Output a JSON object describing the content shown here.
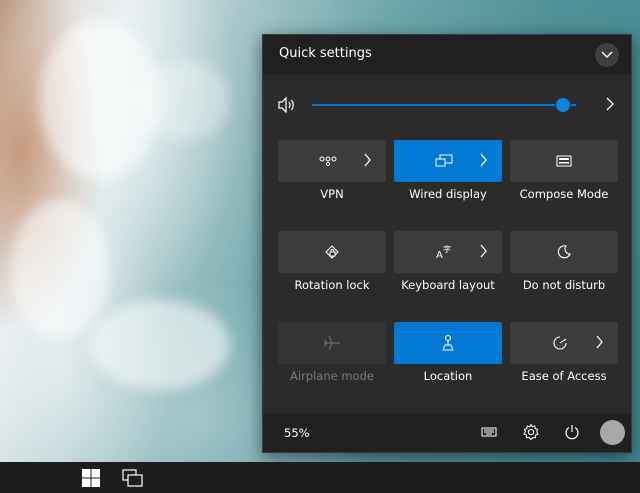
{
  "quick_settings": {
    "title": "Quick settings",
    "volume": {
      "level": 0.95
    },
    "tiles": [
      {
        "id": "vpn",
        "label": "VPN",
        "state": "off",
        "has_chevron": true,
        "icon": "vpn-icon"
      },
      {
        "id": "wired-display",
        "label": "Wired display",
        "state": "on",
        "has_chevron": true,
        "icon": "wired-display-icon"
      },
      {
        "id": "compose-mode",
        "label": "Compose Mode",
        "state": "off",
        "has_chevron": false,
        "icon": "keyboard-icon"
      },
      {
        "id": "rotation-lock",
        "label": "Rotation lock",
        "state": "off",
        "has_chevron": false,
        "icon": "rotation-lock-icon"
      },
      {
        "id": "keyboard-layout",
        "label": "Keyboard layout",
        "state": "off",
        "has_chevron": true,
        "icon": "keyboard-layout-icon"
      },
      {
        "id": "do-not-disturb",
        "label": "Do not disturb",
        "state": "off",
        "has_chevron": false,
        "icon": "moon-icon"
      },
      {
        "id": "airplane-mode",
        "label": "Airplane mode",
        "state": "disabled",
        "has_chevron": false,
        "icon": "airplane-icon"
      },
      {
        "id": "location",
        "label": "Location",
        "state": "on",
        "has_chevron": false,
        "icon": "location-icon"
      },
      {
        "id": "ease-of-access",
        "label": "Ease of Access",
        "state": "off",
        "has_chevron": true,
        "icon": "accessibility-icon"
      }
    ],
    "footer": {
      "battery": "55%",
      "icons": [
        "keyboard-icon",
        "gear-icon",
        "power-icon",
        "avatar"
      ]
    }
  },
  "taskbar": {
    "icons": [
      "windows-start-icon",
      "task-view-icon"
    ]
  },
  "colors": {
    "accent": "#0078d4",
    "panel_bg": "#2b2b2b",
    "header_bg": "#202020",
    "tile_bg": "#3c3c3c",
    "taskbar_bg": "#1d1d1d"
  }
}
